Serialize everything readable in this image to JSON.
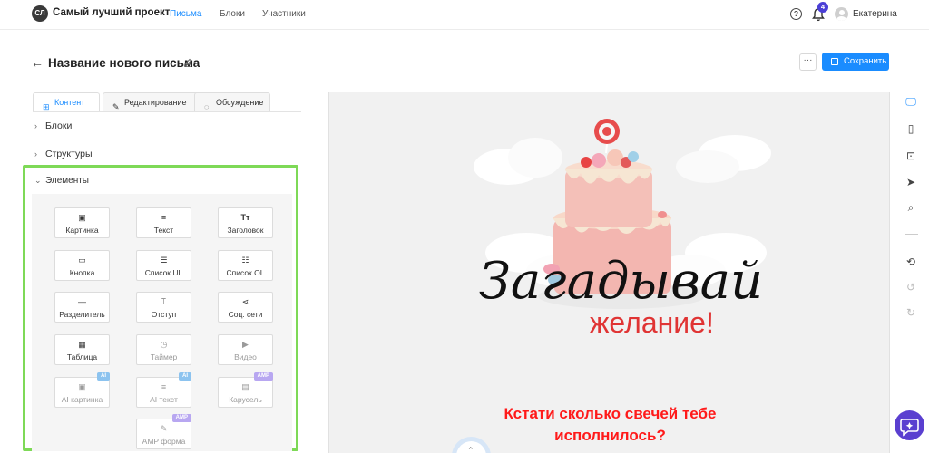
{
  "header": {
    "logo_text": "СЛ",
    "project_name": "Самый лучший проект",
    "nav": [
      "Письма",
      "Блоки",
      "Участники"
    ],
    "notifications_count": "4",
    "user_name": "Екатерина"
  },
  "page": {
    "title": "Название нового письма",
    "more_label": "···",
    "save_label": "Сохранить"
  },
  "tabs": [
    {
      "label": "Контент",
      "icon": "blocks-icon",
      "active": true
    },
    {
      "label": "Редактирование",
      "icon": "pencil-icon",
      "active": false
    },
    {
      "label": "Обсуждение",
      "icon": "chat-bubble-icon",
      "active": false
    }
  ],
  "sections": {
    "blocks": "Блоки",
    "structures": "Структуры",
    "elements": "Элементы"
  },
  "elements": [
    {
      "label": "Картинка",
      "icon": "image-icon",
      "enabled": true
    },
    {
      "label": "Текст",
      "icon": "text-lines-icon",
      "enabled": true
    },
    {
      "label": "Заголовок",
      "icon": "heading-icon",
      "enabled": true
    },
    {
      "label": "Кнопка",
      "icon": "button-icon",
      "enabled": true
    },
    {
      "label": "Список UL",
      "icon": "bullet-list-icon",
      "enabled": true
    },
    {
      "label": "Список OL",
      "icon": "numbered-list-icon",
      "enabled": true
    },
    {
      "label": "Разделитель",
      "icon": "divider-icon",
      "enabled": true
    },
    {
      "label": "Отступ",
      "icon": "spacer-icon",
      "enabled": true
    },
    {
      "label": "Соц. сети",
      "icon": "share-icon",
      "enabled": true
    },
    {
      "label": "Таблица",
      "icon": "table-icon",
      "enabled": true
    },
    {
      "label": "Таймер",
      "icon": "clock-icon",
      "enabled": false
    },
    {
      "label": "Видео",
      "icon": "video-icon",
      "enabled": false
    },
    {
      "label": "AI картинка",
      "icon": "image-icon",
      "enabled": false,
      "tag": "AI"
    },
    {
      "label": "AI текст",
      "icon": "text-lines-icon",
      "enabled": false,
      "tag": "AI"
    },
    {
      "label": "Карусель",
      "icon": "carousel-icon",
      "enabled": false,
      "tag": "AMP"
    },
    {
      "label": "AMP форма",
      "icon": "form-edit-icon",
      "enabled": false,
      "tag": "AMP"
    }
  ],
  "preview": {
    "banner_word1": "Загадывай",
    "banner_word2": "желание!",
    "cta_line1": "Кстати сколько свечей тебе",
    "cta_line2": "исполнилось?"
  },
  "right_rail": [
    "desktop-icon",
    "mobile-icon",
    "code-icon",
    "send-icon",
    "search-doc-icon",
    "history-icon",
    "undo-icon",
    "redo-icon"
  ],
  "colors": {
    "accent": "#1a8cff",
    "highlight": "#7ed957",
    "cta": "#ff1a1a",
    "chat": "#5a3fd0"
  }
}
